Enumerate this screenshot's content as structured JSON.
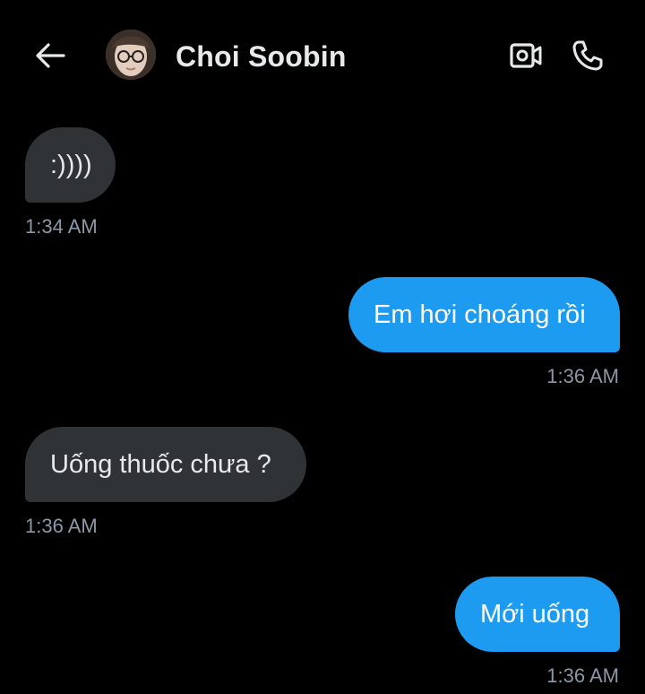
{
  "header": {
    "contact_name": "Choi Soobin",
    "back_icon": "arrow-left-icon",
    "video_icon": "video-call-icon",
    "call_icon": "phone-icon"
  },
  "colors": {
    "background": "#000000",
    "incoming_bubble": "#2f3336",
    "outgoing_bubble": "#1d9bf0",
    "timestamp": "#8b98a5",
    "text": "#e7e9ea"
  },
  "messages": [
    {
      "direction": "incoming",
      "text": ":))))",
      "time": "1:34 AM"
    },
    {
      "direction": "outgoing",
      "text": "Em hơi choáng rồi",
      "time": "1:36 AM"
    },
    {
      "direction": "incoming",
      "text": "Uống thuốc chưa ?",
      "time": "1:36 AM"
    },
    {
      "direction": "outgoing",
      "text": "Mới uống",
      "time": "1:36 AM"
    }
  ]
}
